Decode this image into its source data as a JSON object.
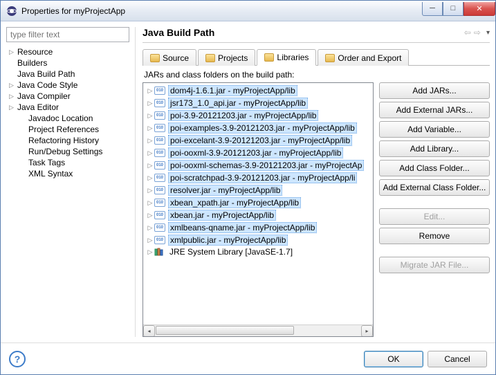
{
  "window": {
    "title": "Properties for myProjectApp"
  },
  "filter": {
    "placeholder": "type filter text"
  },
  "tree": [
    {
      "label": "Resource",
      "expandable": true
    },
    {
      "label": "Builders",
      "expandable": false
    },
    {
      "label": "Java Build Path",
      "expandable": false
    },
    {
      "label": "Java Code Style",
      "expandable": true
    },
    {
      "label": "Java Compiler",
      "expandable": true
    },
    {
      "label": "Java Editor",
      "expandable": true
    },
    {
      "label": "Javadoc Location",
      "expandable": false,
      "child": true
    },
    {
      "label": "Project References",
      "expandable": false,
      "child": true
    },
    {
      "label": "Refactoring History",
      "expandable": false,
      "child": true
    },
    {
      "label": "Run/Debug Settings",
      "expandable": false,
      "child": true
    },
    {
      "label": "Task Tags",
      "expandable": false,
      "child": true
    },
    {
      "label": "XML Syntax",
      "expandable": false,
      "child": true
    }
  ],
  "heading": "Java Build Path",
  "tabs": [
    {
      "label": "Source"
    },
    {
      "label": "Projects"
    },
    {
      "label": "Libraries",
      "active": true
    },
    {
      "label": "Order and Export"
    }
  ],
  "listHeader": "JARs and class folders on the build path:",
  "jars": [
    "dom4j-1.6.1.jar - myProjectApp/lib",
    "jsr173_1.0_api.jar - myProjectApp/lib",
    "poi-3.9-20121203.jar - myProjectApp/lib",
    "poi-examples-3.9-20121203.jar - myProjectApp/lib",
    "poi-excelant-3.9-20121203.jar - myProjectApp/lib",
    "poi-ooxml-3.9-20121203.jar - myProjectApp/lib",
    "poi-ooxml-schemas-3.9-20121203.jar - myProjectAp",
    "poi-scratchpad-3.9-20121203.jar - myProjectApp/li",
    "resolver.jar - myProjectApp/lib",
    "xbean_xpath.jar - myProjectApp/lib",
    "xbean.jar - myProjectApp/lib",
    "xmlbeans-qname.jar - myProjectApp/lib",
    "xmlpublic.jar - myProjectApp/lib"
  ],
  "systemLib": "JRE System Library [JavaSE-1.7]",
  "buttons": {
    "addJars": "Add JARs...",
    "addExtJars": "Add External JARs...",
    "addVar": "Add Variable...",
    "addLib": "Add Library...",
    "addClassFolder": "Add Class Folder...",
    "addExtClassFolder": "Add External Class Folder...",
    "edit": "Edit...",
    "remove": "Remove",
    "migrate": "Migrate JAR File..."
  },
  "footer": {
    "ok": "OK",
    "cancel": "Cancel"
  }
}
